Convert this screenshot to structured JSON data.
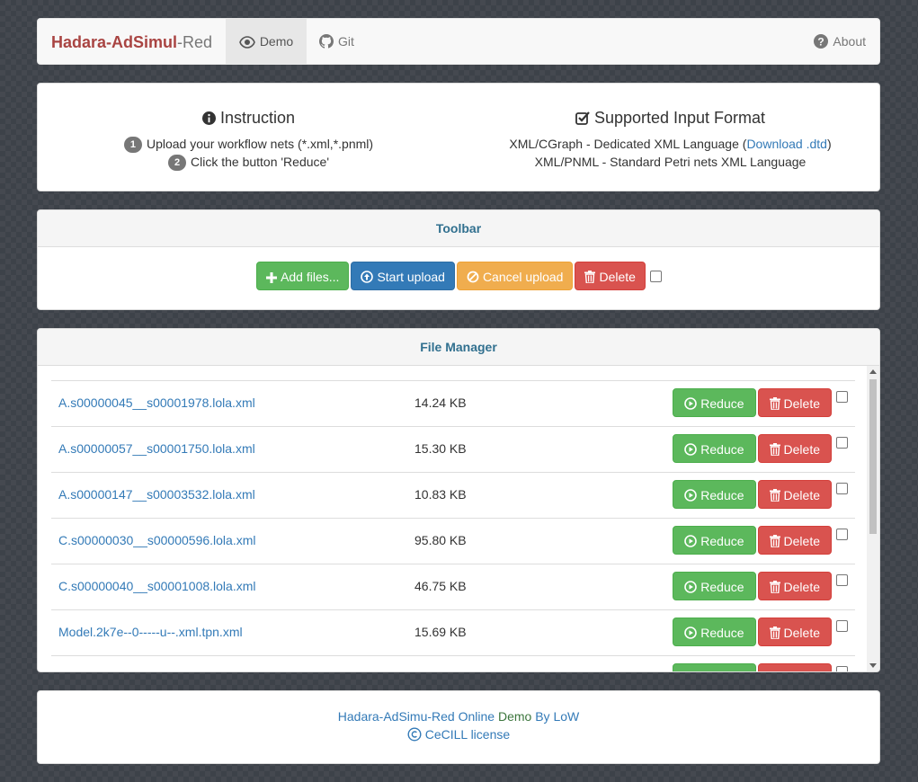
{
  "nav": {
    "brand_part1": "Hadara-AdSimul",
    "brand_part2": "-Red",
    "demo": "Demo",
    "git": "Git",
    "about": "About"
  },
  "instruction": {
    "title": "Instruction",
    "step1_num": "1",
    "step1": "Upload your workflow nets (*.xml,*.pnml)",
    "step2_num": "2",
    "step2": "Click the button 'Reduce'"
  },
  "formats": {
    "title": "Supported Input Format",
    "line1_prefix": "XML/CGraph - Dedicated XML Language (",
    "line1_link": "Download .dtd",
    "line1_suffix": ")",
    "line2": "XML/PNML - Standard Petri nets XML Language"
  },
  "toolbar": {
    "title": "Toolbar",
    "add": "Add files...",
    "start": "Start upload",
    "cancel": "Cancel upload",
    "delete": "Delete"
  },
  "file_manager": {
    "title": "File Manager",
    "reduce_label": "Reduce",
    "delete_label": "Delete",
    "files": [
      {
        "name": "A.s00000045__s00001978.lola.xml",
        "size": "14.24 KB"
      },
      {
        "name": "A.s00000057__s00001750.lola.xml",
        "size": "15.30 KB"
      },
      {
        "name": "A.s00000147__s00003532.lola.xml",
        "size": "10.83 KB"
      },
      {
        "name": "C.s00000030__s00000596.lola.xml",
        "size": "95.80 KB"
      },
      {
        "name": "C.s00000040__s00001008.lola.xml",
        "size": "46.75 KB"
      },
      {
        "name": "Model.2k7e--0-----u--.xml.tpn.xml",
        "size": "15.69 KB"
      }
    ]
  },
  "footer": {
    "line1_a": "Hadara-AdSimu-Red Online",
    "line1_b": "Demo",
    "line1_c": "By LoW",
    "license": "CeCILL license"
  }
}
